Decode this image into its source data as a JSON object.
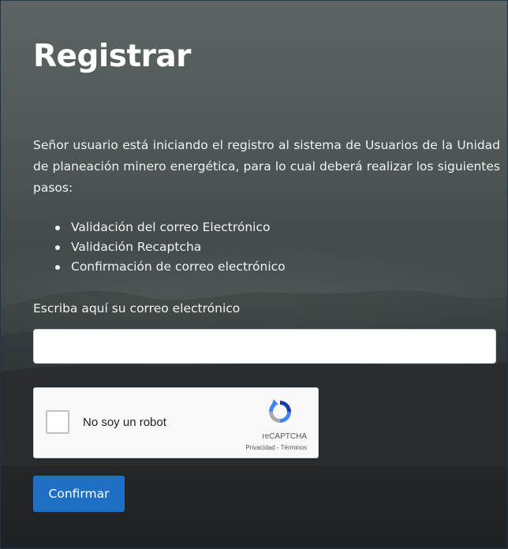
{
  "page": {
    "title": "Registrar",
    "intro": "Señor usuario está iniciando el registro al sistema de Usuarios de la Unidad de planeación minero energética, para lo cual deberá realizar los siguientes pasos:",
    "steps": [
      "Validación del correo Electrónico",
      "Validación Recaptcha",
      "Confirmación de correo electrónico"
    ]
  },
  "form": {
    "email_label": "Escriba aquí su correo electrónico",
    "email_value": "",
    "email_placeholder": "",
    "submit_label": "Confirmar"
  },
  "recaptcha": {
    "checkbox_label": "No soy un robot",
    "brand": "reCAPTCHA",
    "privacy_link": "Privacidad",
    "separator": " - ",
    "terms_link": "Términos",
    "logo_icon": "recaptcha-logo-icon"
  },
  "colors": {
    "button": "#1f6fc5",
    "text": "#f2f2f2",
    "frame_border": "#243447"
  }
}
